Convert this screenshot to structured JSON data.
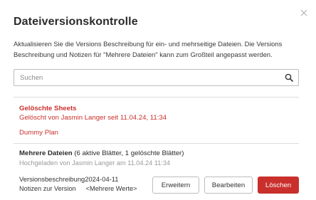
{
  "dialog": {
    "title": "Dateiversionskontrolle",
    "description": "Aktualisieren Sie die Versions Beschreibung für ein- und mehrseitige Dateien. Die Versions Beschreibung und Notizen für \"Mehrere Dateien\" kann zum Großteil angepasst werden.",
    "close_icon": "close-icon"
  },
  "search": {
    "placeholder": "Suchen",
    "value": "",
    "icon": "search-icon"
  },
  "deleted_section": {
    "heading": "Gelöschte Sheets",
    "subtitle": "Gelöscht von Jasmin Langer seit 11.04.24, 11:34",
    "items": [
      "Dummy Plan"
    ],
    "color": "#c9302c"
  },
  "multi_files": {
    "heading_bold": "Mehrere Dateien",
    "heading_rest": "(6 aktive Blätter, 1 gelöschte Blätter)",
    "uploaded": "Hochgeladen von Jasmin Langer am 11.04.24 11:34",
    "version_label": "Versionsbeschreibung",
    "version_value": "2024-04-11",
    "notes_label": "Notizen zur Version",
    "notes_value": "<Mehrere Werte>"
  },
  "buttons": {
    "expand": "Erweitern",
    "edit": "Bearbeiten",
    "delete": "Löschen",
    "delete_color": "#c9302c"
  }
}
